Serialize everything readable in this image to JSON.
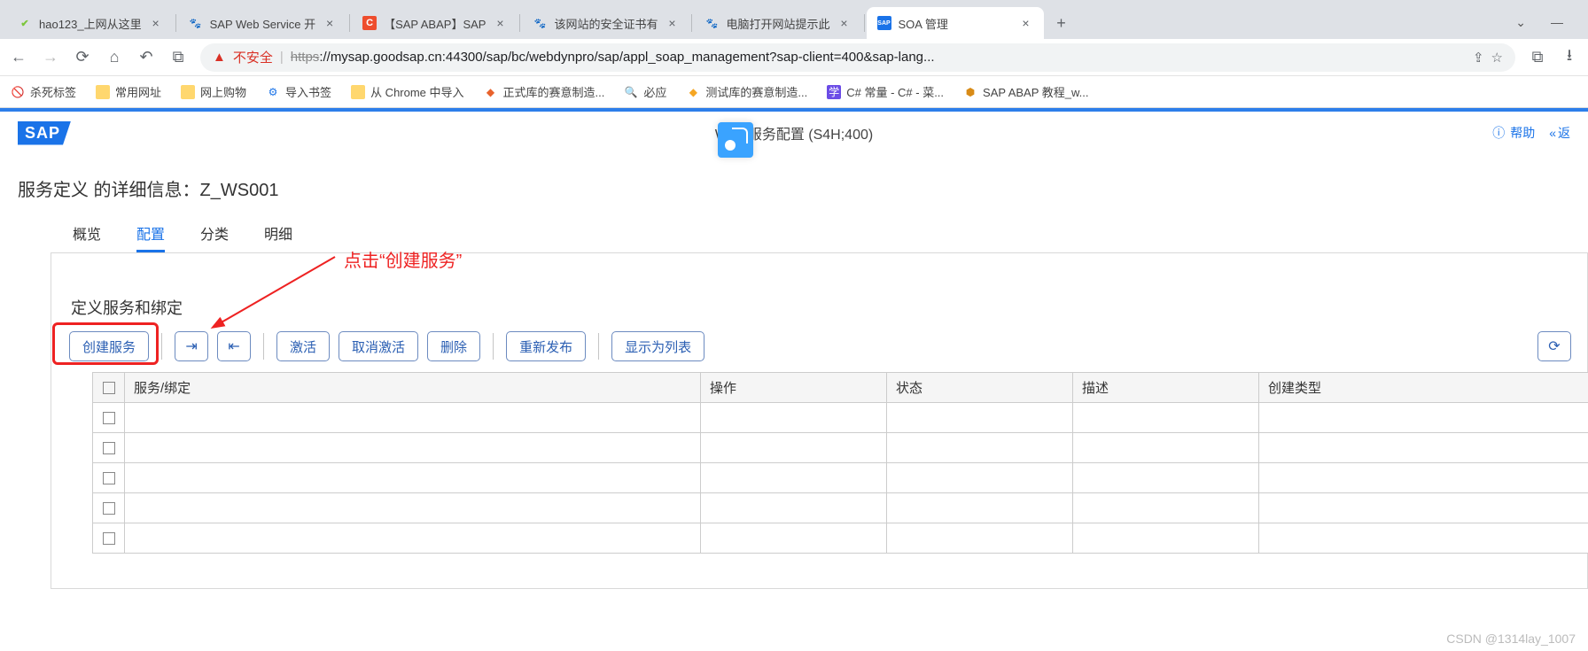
{
  "browser": {
    "tabs": [
      {
        "favicon_color": "#7cc63b",
        "favicon_text": "",
        "title": "hao123_上网从这里"
      },
      {
        "favicon_text": "熊",
        "favicon_color": "#2d7eea",
        "title": "SAP Web Service 开"
      },
      {
        "favicon_text": "C",
        "favicon_bg": "#ee4d2d",
        "title": "【SAP ABAP】SAP"
      },
      {
        "favicon_text": "熊",
        "favicon_color": "#2d7eea",
        "title": "该网站的安全证书有"
      },
      {
        "favicon_text": "熊",
        "favicon_color": "#2d7eea",
        "title": "电脑打开网站提示此"
      },
      {
        "favicon_text": "SAP",
        "favicon_bg": "#1a73e8",
        "title": "SOA 管理",
        "active": true
      }
    ],
    "addr": {
      "warn": "不安全",
      "url_proto": "https",
      "url_rest": "://mysap.goodsap.cn:44300/sap/bc/webdynpro/sap/appl_soap_management?sap-client=400&sap-lang..."
    },
    "bookmarks": [
      {
        "icon": "⛔",
        "label": "杀死标签"
      },
      {
        "icon": "folder",
        "label": "常用网址"
      },
      {
        "icon": "folder",
        "label": "网上购物"
      },
      {
        "icon": "⚙",
        "color": "#1a73e8",
        "label": "导入书签"
      },
      {
        "icon": "folder",
        "label": "从 Chrome 中导入"
      },
      {
        "icon": "🛡",
        "color": "#e8622c",
        "label": "正式库的赛意制造..."
      },
      {
        "icon": "🔍",
        "color": "#1a73e8",
        "label": "必应"
      },
      {
        "icon": "🛡",
        "color": "#f5a623",
        "label": "测试库的赛意制造..."
      },
      {
        "icon": "学",
        "bg": "#6b4ce6",
        "label": "C# 常量 - C# - 菜..."
      },
      {
        "icon": "⬢",
        "color": "#d88b17",
        "label": "SAP ABAP 教程_w..."
      }
    ]
  },
  "sap": {
    "logo": "SAP",
    "header_title": "Web 服务配置 (S4H;400)",
    "help": "帮助",
    "back": "返"
  },
  "page": {
    "detail_title": "服务定义 的详细信息：Z_WS001",
    "tabs": [
      "概览",
      "配置",
      "分类",
      "明细"
    ],
    "active_tab": 1,
    "annotation": "点击“创建服务”",
    "section_title": "定义服务和绑定",
    "toolbar": {
      "create": "创建服务",
      "activate": "激活",
      "deactivate": "取消激活",
      "delete": "删除",
      "republish": "重新发布",
      "as_list": "显示为列表"
    },
    "table_headers": [
      "服务/绑定",
      "操作",
      "状态",
      "描述",
      "创建类型"
    ],
    "rows": 5
  },
  "watermark": "CSDN @1314lay_1007"
}
